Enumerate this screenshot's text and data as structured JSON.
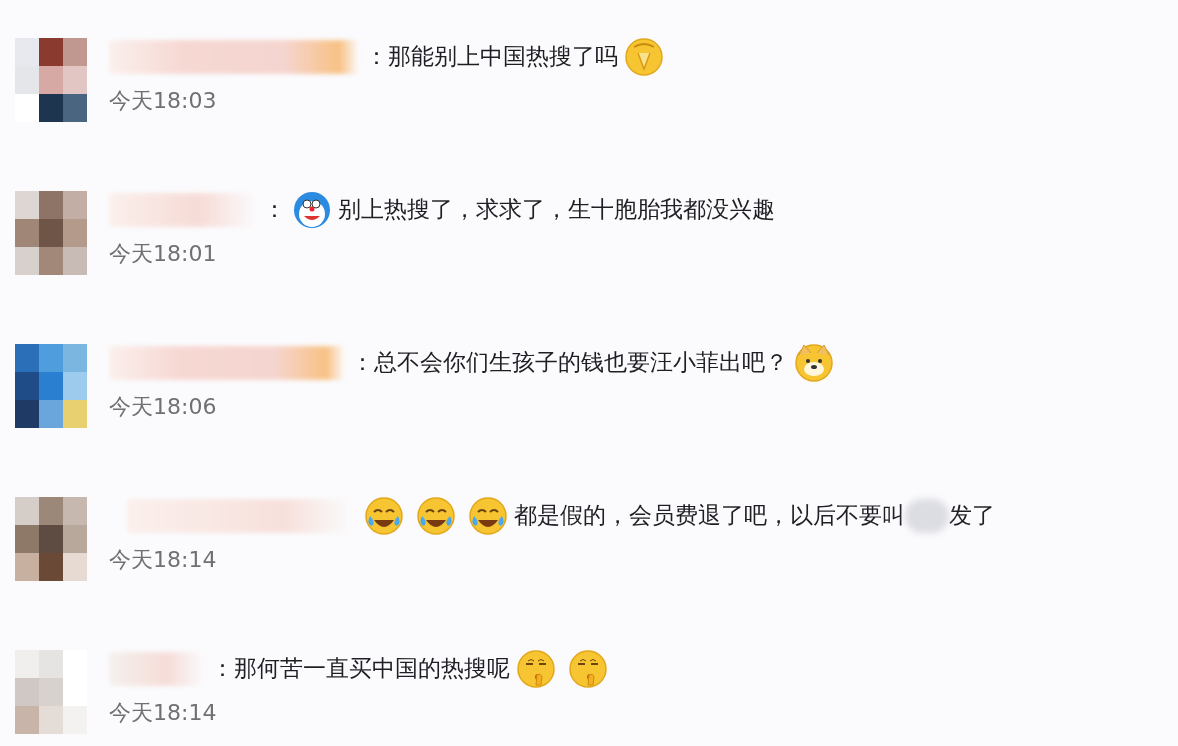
{
  "comments": [
    {
      "segments": [
        {
          "kind": "text",
          "text": "："
        },
        {
          "kind": "text",
          "text": "那能别上中国热搜了吗"
        },
        {
          "kind": "facepalm"
        }
      ],
      "time": "今天18:03"
    },
    {
      "segments": [
        {
          "kind": "text",
          "text": "："
        },
        {
          "kind": "robot"
        },
        {
          "kind": "text",
          "text": "别上热搜了，求求了，生十胞胎我都没兴趣"
        }
      ],
      "time": "今天18:01"
    },
    {
      "segments": [
        {
          "kind": "text",
          "text": "："
        },
        {
          "kind": "text",
          "text": "总不会你们生孩子的钱也要汪小菲出吧？"
        },
        {
          "kind": "dog"
        }
      ],
      "time": "今天18:06"
    },
    {
      "segments": [
        {
          "kind": "laughing"
        },
        {
          "kind": "laughing"
        },
        {
          "kind": "laughing"
        },
        {
          "kind": "text",
          "text": "都是假的，会员费退了吧，以后不要叫"
        },
        {
          "kind": "blur"
        },
        {
          "kind": "text",
          "text": "发了"
        }
      ],
      "time": "今天18:14"
    },
    {
      "segments": [
        {
          "kind": "text",
          "text": "："
        },
        {
          "kind": "text",
          "text": "那何苦一直买中国的热搜呢"
        },
        {
          "kind": "shush"
        },
        {
          "kind": "shush"
        }
      ],
      "time": "今天18:14"
    }
  ]
}
